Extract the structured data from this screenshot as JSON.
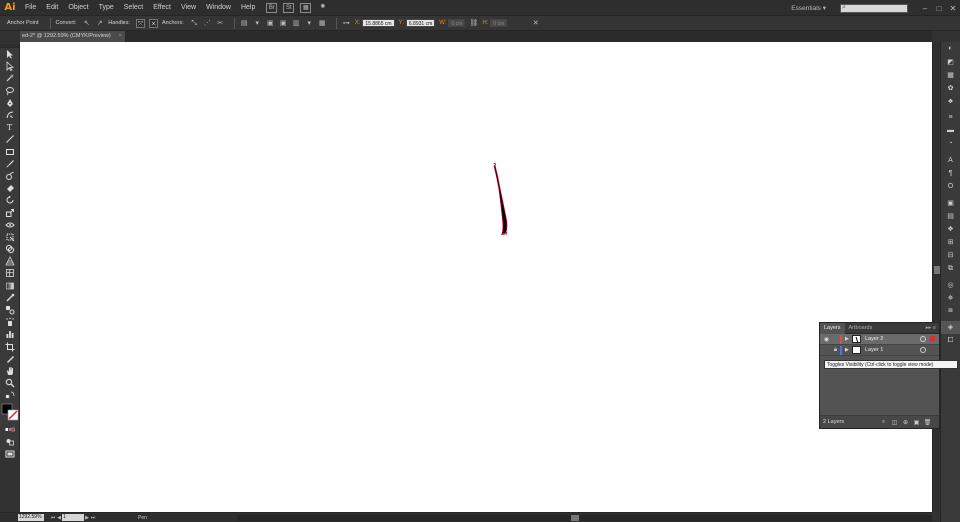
{
  "app": {
    "logo": "Ai"
  },
  "menu": [
    "File",
    "Edit",
    "Object",
    "Type",
    "Select",
    "Effect",
    "View",
    "Window",
    "Help"
  ],
  "menubar_icons": [
    "Br",
    "St"
  ],
  "workspace": "Essentials ▾",
  "window_buttons": [
    "–",
    "□",
    "✕"
  ],
  "control": {
    "mode_label": "Anchor Point",
    "convert_label": "Convert:",
    "handles_label": "Handles:",
    "anchors_label": "Anchors:",
    "x_label": "X:",
    "x_value": "15.8865 cm",
    "y_label": "Y:",
    "y_value": "6.8931 cm",
    "w_label": "W:",
    "w_value": "0 cm",
    "h_label": "H:",
    "h_value": "0 cm"
  },
  "document": {
    "tab_title": "ed-2* @ 1292.59% (CMYK/Preview)",
    "close": "×"
  },
  "layers_panel": {
    "tabs": [
      "Layers",
      "Artboards"
    ],
    "menu": "▸▸ ≡",
    "rows": [
      {
        "name": "Layer 2",
        "color": "#e84a4a",
        "selected": true
      },
      {
        "name": "Layer 1",
        "color": "#4a78e8",
        "selected": false
      }
    ],
    "count": "2 Layers"
  },
  "tooltip": "Toggles Visibility (Ctrl-click to toggle view mode)",
  "status": {
    "zoom": "1292.59%",
    "page": "1",
    "tool": "Pen"
  },
  "colors": {
    "accent": "#ff9a00",
    "stroke": "#000000",
    "path_highlight": "#cc0033"
  }
}
